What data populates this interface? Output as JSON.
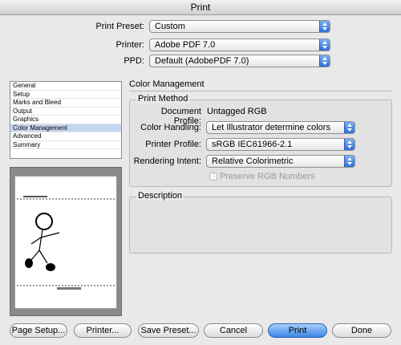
{
  "window": {
    "title": "Print"
  },
  "top": {
    "preset_label": "Print Preset:",
    "preset_value": "Custom",
    "printer_label": "Printer:",
    "printer_value": "Adobe PDF 7.0",
    "ppd_label": "PPD:",
    "ppd_value": "Default (AdobePDF 7.0)"
  },
  "sidebar": {
    "items": [
      {
        "label": "General"
      },
      {
        "label": "Setup"
      },
      {
        "label": "Marks and Bleed"
      },
      {
        "label": "Output"
      },
      {
        "label": "Graphics"
      },
      {
        "label": "Color Management"
      },
      {
        "label": "Advanced"
      },
      {
        "label": "Summary"
      }
    ],
    "selected": "Color Management"
  },
  "panel": {
    "title": "Color Management",
    "print_method": {
      "group_title": "Print Method",
      "doc_profile_label": "Document Profile:",
      "doc_profile_value": "Untagged RGB",
      "color_handling_label": "Color Handling:",
      "color_handling_value": "Let Illustrator determine colors",
      "printer_profile_label": "Printer Profile:",
      "printer_profile_value": "sRGB IEC61966-2.1",
      "rendering_intent_label": "Rendering Intent:",
      "rendering_intent_value": "Relative Colorimetric",
      "preserve_rgb_label": "Preserve RGB Numbers",
      "preserve_rgb_checked": false
    },
    "description": {
      "group_title": "Description"
    }
  },
  "buttons": {
    "page_setup": "Page Setup...",
    "printer": "Printer...",
    "save_preset": "Save Preset...",
    "cancel": "Cancel",
    "print": "Print",
    "done": "Done"
  },
  "colors": {
    "accent": "#3b86e8",
    "selection": "#c5d6f0"
  }
}
